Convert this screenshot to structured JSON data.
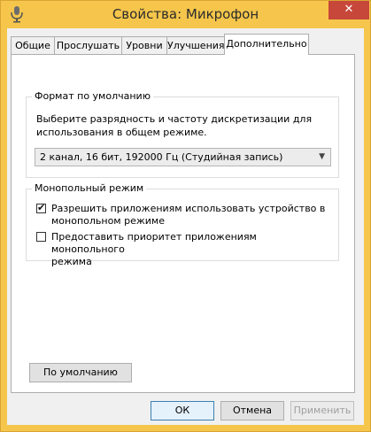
{
  "window": {
    "title": "Свойства: Микрофон",
    "close_glyph": "✕"
  },
  "tabs": [
    {
      "label": "Общие"
    },
    {
      "label": "Прослушать"
    },
    {
      "label": "Уровни"
    },
    {
      "label": "Улучшения"
    },
    {
      "label": "Дополнительно",
      "active": true
    }
  ],
  "default_format": {
    "legend": "Формат по умолчанию",
    "description_line1": "Выберите разрядность и частоту дискретизации для",
    "description_line2": "использования в общем режиме.",
    "selected_value": "2 канал, 16 бит, 192000 Гц (Студийная запись)"
  },
  "exclusive_mode": {
    "legend": "Монопольный режим",
    "options": [
      {
        "line1": "Разрешить приложениям использовать устройство в",
        "line2": "монопольном режиме",
        "checked": true
      },
      {
        "line1": "Предоставить приоритет приложениям монопольного",
        "line2": "режима",
        "checked": false
      }
    ]
  },
  "buttons": {
    "restore_default": "По умолчанию",
    "ok": "ОК",
    "cancel": "Отмена",
    "apply": "Применить"
  },
  "icons": {
    "app": "microphone-icon",
    "dropdown": "chevron-down-icon",
    "check": "checkmark-icon"
  },
  "colors": {
    "titlebar": "#f5c64b",
    "close_button": "#c7473a"
  }
}
